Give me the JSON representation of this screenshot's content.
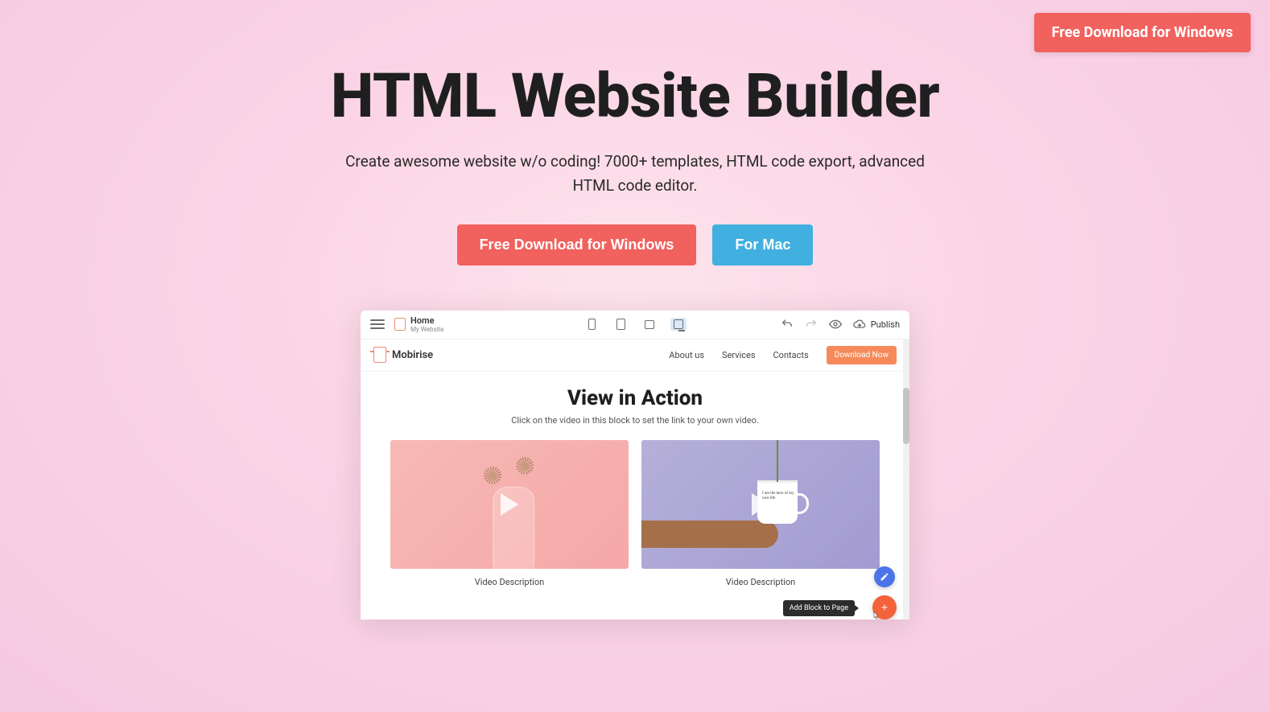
{
  "top_cta_label": "Free Download for Windows",
  "hero": {
    "title": "HTML Website Builder",
    "subtitle": "Create awesome website w/o coding! 7000+ templates, HTML code export, advanced HTML code editor.",
    "primary_btn": "Free Download for Windows",
    "secondary_btn": "For Mac"
  },
  "app": {
    "page_name": "Home",
    "site_name": "My Website",
    "publish_label": "Publish",
    "brand": "Mobirise",
    "nav": {
      "about": "About us",
      "services": "Services",
      "contacts": "Contacts",
      "cta": "Download Now"
    },
    "content": {
      "heading": "View in Action",
      "hint": "Click on the video in this block to set the link to your own video.",
      "video1_desc": "Video Description",
      "video2_desc": "Video Description",
      "cup_text": "I am the hero of my own life"
    },
    "tooltip": "Add Block to Page"
  }
}
